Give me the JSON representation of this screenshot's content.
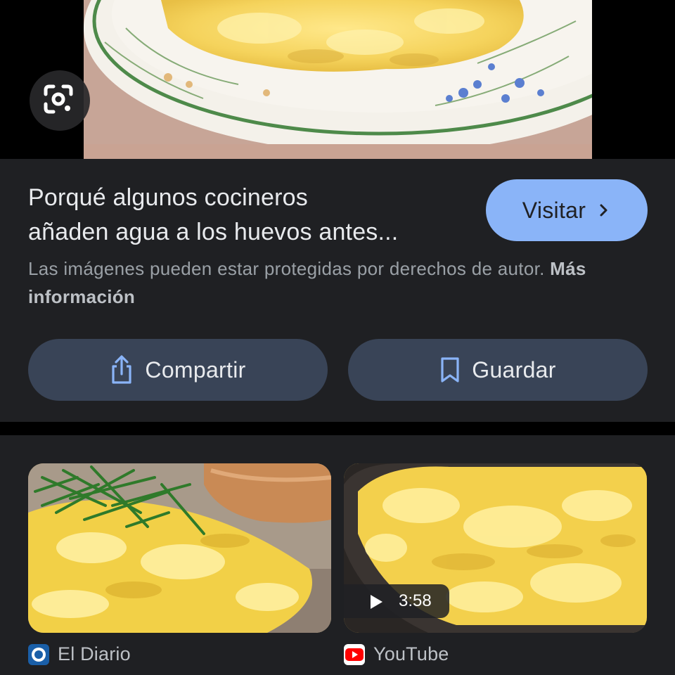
{
  "result": {
    "title_line1": "Porqué algunos cocineros",
    "title_line2": "añaden agua a los huevos antes...",
    "visit_label": "Visitar",
    "copyright_text": "Las imágenes pueden estar protegidas por derechos de autor.",
    "more_info_label": "Más información",
    "share_label": "Compartir",
    "save_label": "Guardar"
  },
  "related": [
    {
      "source": "El Diario",
      "favicon": "el-diario-logo"
    },
    {
      "source": "YouTube",
      "favicon": "youtube-logo",
      "duration": "3:58"
    }
  ],
  "colors": {
    "card_bg": "#1f2023",
    "accent": "#8ab4f8",
    "pill_bg": "#394457"
  }
}
